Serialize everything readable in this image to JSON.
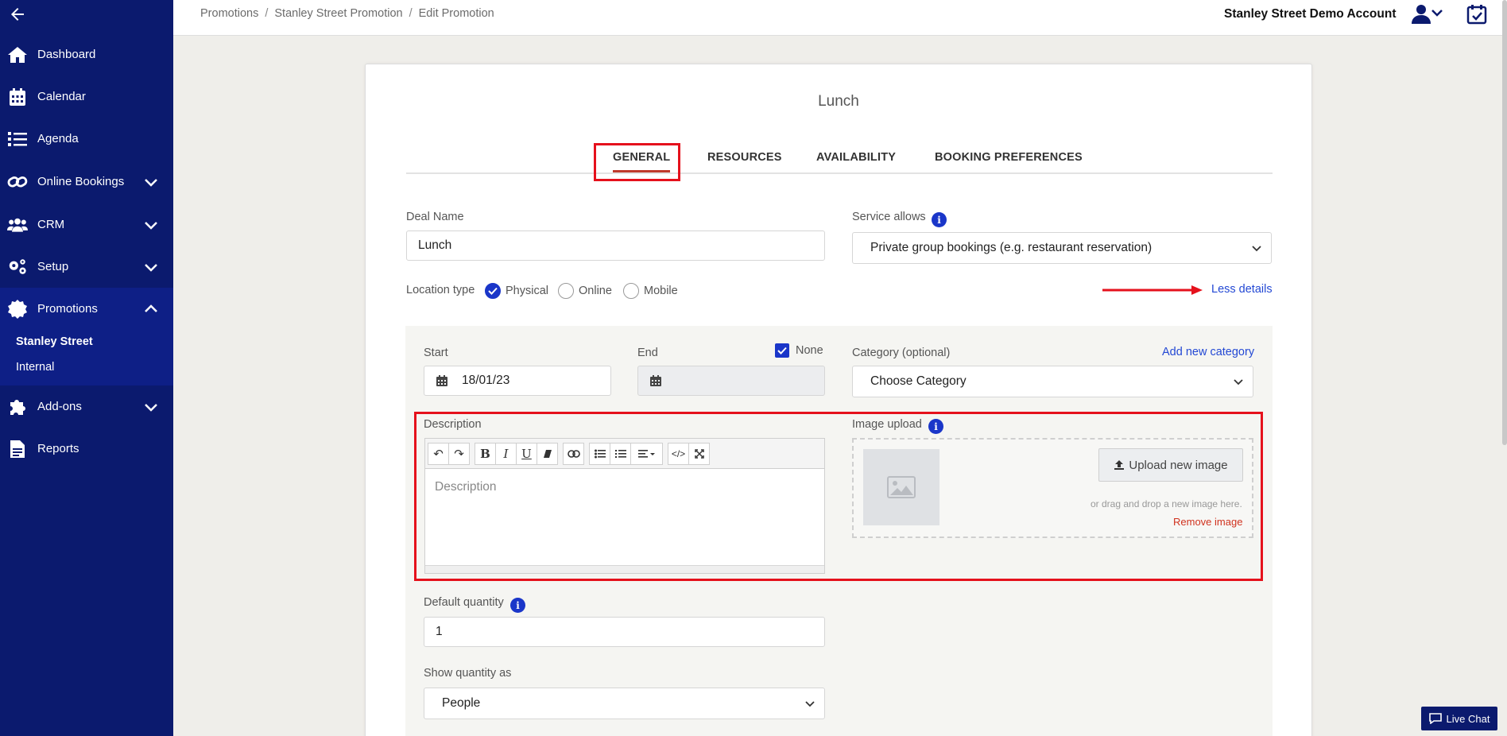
{
  "sidebar": {
    "items": [
      {
        "label": "Dashboard",
        "icon": "home-icon"
      },
      {
        "label": "Calendar",
        "icon": "calendar-icon"
      },
      {
        "label": "Agenda",
        "icon": "list-icon"
      },
      {
        "label": "Online Bookings",
        "icon": "link-icon"
      },
      {
        "label": "CRM",
        "icon": "users-icon"
      },
      {
        "label": "Setup",
        "icon": "gears-icon"
      },
      {
        "label": "Promotions",
        "icon": "badge-icon"
      },
      {
        "label": "Add-ons",
        "icon": "puzzle-icon"
      },
      {
        "label": "Reports",
        "icon": "file-icon"
      }
    ],
    "submenu": [
      "Stanley Street",
      "Internal"
    ]
  },
  "header": {
    "breadcrumbs": [
      "Promotions",
      "Stanley Street Promotion",
      "Edit Promotion"
    ],
    "account": "Stanley Street Demo Account"
  },
  "card": {
    "title": "Lunch",
    "tabs": [
      "GENERAL",
      "RESOURCES",
      "AVAILABILITY",
      "BOOKING PREFERENCES"
    ]
  },
  "form": {
    "deal_name_label": "Deal Name",
    "deal_name_value": "Lunch",
    "service_allows_label": "Service allows",
    "service_allows_value": "Private group bookings (e.g. restaurant reservation)",
    "location_type_label": "Location type",
    "location_options": [
      "Physical",
      "Online",
      "Mobile"
    ],
    "less_details": "Less details",
    "start_label": "Start",
    "start_value": "18/01/23",
    "end_label": "End",
    "none_label": "None",
    "category_label": "Category (optional)",
    "add_category": "Add new category",
    "category_value": "Choose Category",
    "description_label": "Description",
    "description_placeholder": "Description",
    "image_upload_label": "Image upload",
    "upload_button": "Upload new image",
    "drop_hint": "or drag and drop a new image here.",
    "remove_image": "Remove image",
    "default_quantity_label": "Default quantity",
    "default_quantity_value": "1",
    "show_quantity_label": "Show quantity as",
    "show_quantity_value": "People"
  },
  "live_chat": "Live Chat",
  "colors": {
    "sidebar": "#0b1a6e",
    "accent": "#1a36c9",
    "highlight": "#e5111c"
  }
}
